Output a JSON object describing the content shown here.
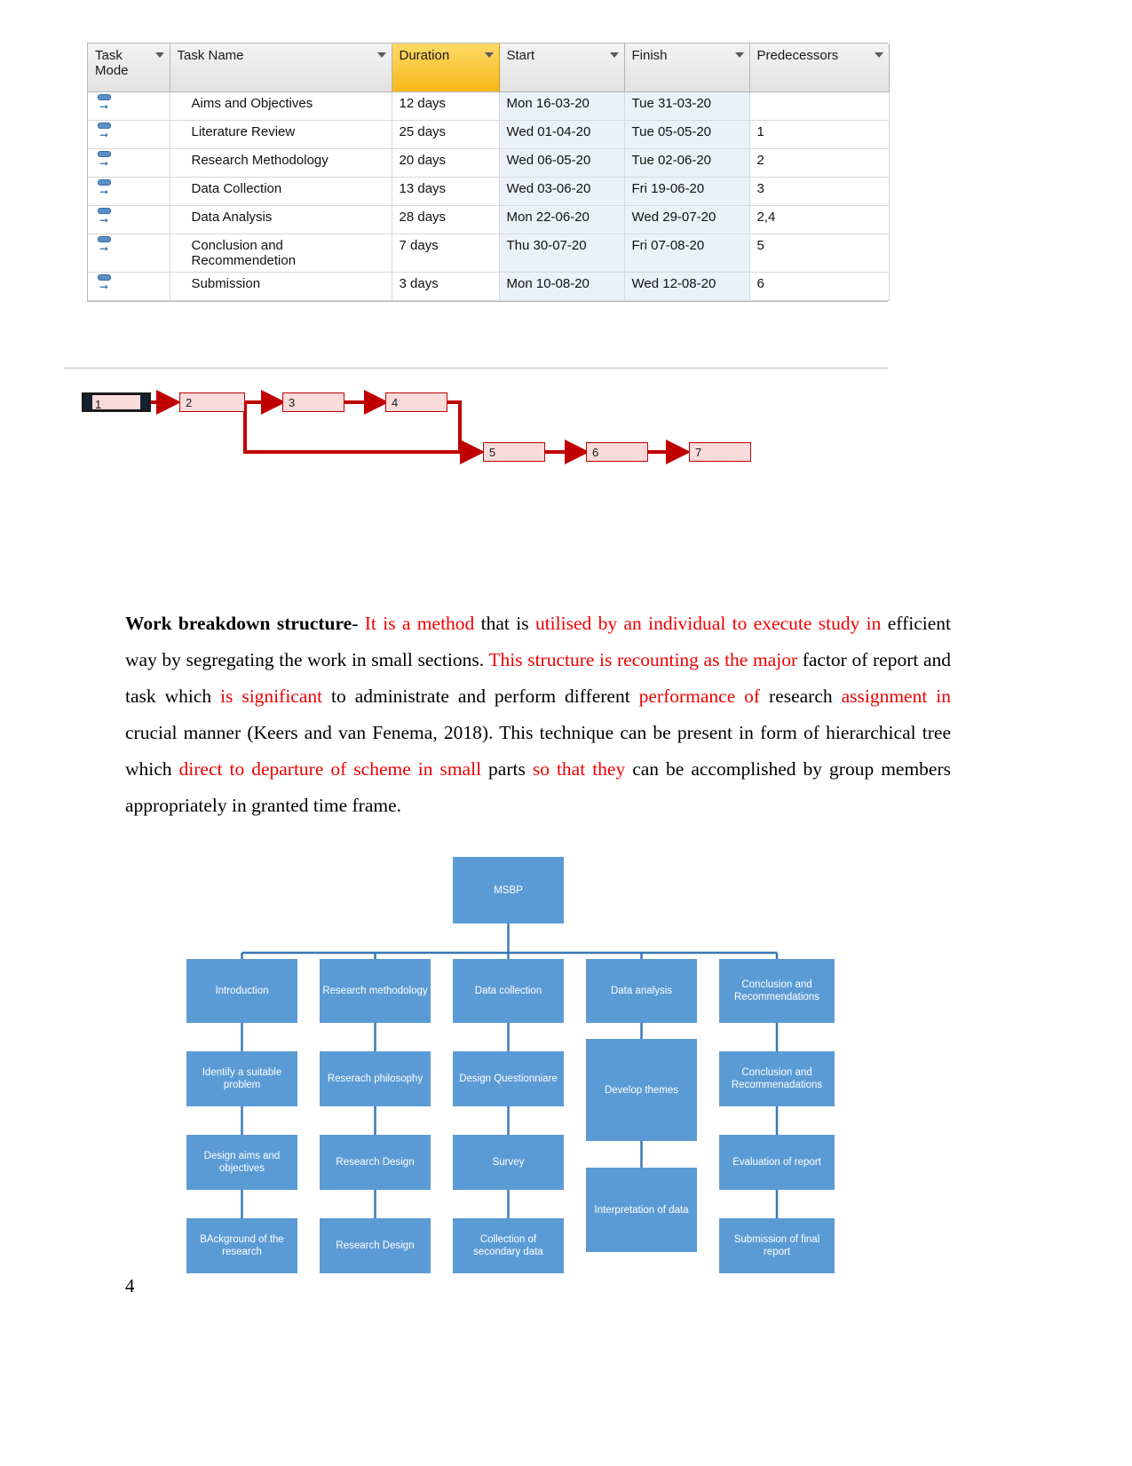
{
  "gantt": {
    "columns": [
      {
        "label": "Task Mode",
        "highlighted": false,
        "has_filter": true
      },
      {
        "label": "Task Name",
        "highlighted": false,
        "has_filter": true
      },
      {
        "label": "Duration",
        "highlighted": true,
        "has_filter": true
      },
      {
        "label": "Start",
        "highlighted": false,
        "has_filter": true
      },
      {
        "label": "Finish",
        "highlighted": false,
        "has_filter": true
      },
      {
        "label": "Predecessors",
        "highlighted": false,
        "has_filter": true
      }
    ],
    "rows": [
      {
        "mode": "auto-schedule-icon",
        "name": "Aims and Objectives",
        "duration": "12 days",
        "start": "Mon 16-03-20",
        "finish": "Tue 31-03-20",
        "predecessors": ""
      },
      {
        "mode": "auto-schedule-icon",
        "name": "Literature Review",
        "duration": "25 days",
        "start": "Wed 01-04-20",
        "finish": "Tue 05-05-20",
        "predecessors": "1"
      },
      {
        "mode": "auto-schedule-icon",
        "name": "Research Methodology",
        "duration": "20 days",
        "start": "Wed 06-05-20",
        "finish": "Tue 02-06-20",
        "predecessors": "2"
      },
      {
        "mode": "auto-schedule-icon",
        "name": "Data Collection",
        "duration": "13 days",
        "start": "Wed 03-06-20",
        "finish": "Fri 19-06-20",
        "predecessors": "3"
      },
      {
        "mode": "auto-schedule-icon",
        "name": "Data Analysis",
        "duration": "28 days",
        "start": "Mon 22-06-20",
        "finish": "Wed 29-07-20",
        "predecessors": "2,4"
      },
      {
        "mode": "auto-schedule-icon",
        "name": "Conclusion and Recommendetion",
        "duration": "7 days",
        "start": "Thu 30-07-20",
        "finish": "Fri 07-08-20",
        "predecessors": "5"
      },
      {
        "mode": "auto-schedule-icon",
        "name": "Submission",
        "duration": "3 days",
        "start": "Mon 10-08-20",
        "finish": "Wed 12-08-20",
        "predecessors": "6"
      }
    ]
  },
  "network_diagram": {
    "node_color": "#fadbdb",
    "line_color": "#c00000",
    "nodes": [
      {
        "id": "1",
        "label": "1",
        "is_start": true
      },
      {
        "id": "2",
        "label": "2",
        "is_start": false
      },
      {
        "id": "3",
        "label": "3",
        "is_start": false
      },
      {
        "id": "4",
        "label": "4",
        "is_start": false
      },
      {
        "id": "5",
        "label": "5",
        "is_start": false
      },
      {
        "id": "6",
        "label": "6",
        "is_start": false
      },
      {
        "id": "7",
        "label": "7",
        "is_start": false
      }
    ],
    "links": [
      {
        "from": "1",
        "to": "2"
      },
      {
        "from": "2",
        "to": "3"
      },
      {
        "from": "3",
        "to": "4"
      },
      {
        "from": "4",
        "to": "5"
      },
      {
        "from": "2",
        "to": "5"
      },
      {
        "from": "5",
        "to": "6"
      },
      {
        "from": "6",
        "to": "7"
      }
    ]
  },
  "paragraph": {
    "segments": [
      {
        "text": "Work breakdown structure",
        "style": "bold"
      },
      {
        "text": "- ",
        "style": "plain"
      },
      {
        "text": "It is a method ",
        "style": "red"
      },
      {
        "text": "that is ",
        "style": "plain"
      },
      {
        "text": "utilised by an individual to execute study in ",
        "style": "red"
      },
      {
        "text": "efficient way by segregating the work in small sections. ",
        "style": "plain"
      },
      {
        "text": "This structure is recounting as the major ",
        "style": "red"
      },
      {
        "text": "factor of report and task which ",
        "style": "plain"
      },
      {
        "text": "is significant ",
        "style": "red"
      },
      {
        "text": "to administrate and perform different ",
        "style": "plain"
      },
      {
        "text": "performance of ",
        "style": "red"
      },
      {
        "text": "research ",
        "style": "plain"
      },
      {
        "text": "assignment in ",
        "style": "red"
      },
      {
        "text": "crucial manner (Keers and van Fenema,  2018). This technique can be present in form of hierarchical tree which ",
        "style": "plain"
      },
      {
        "text": "direct to departure of scheme in small ",
        "style": "red"
      },
      {
        "text": "parts ",
        "style": "plain"
      },
      {
        "text": "so that they ",
        "style": "red"
      },
      {
        "text": "can be accomplished by group members appropriately in granted time frame.",
        "style": "plain"
      }
    ]
  },
  "wbs_chart": {
    "box_color": "#5b9bd5",
    "connector_color": "#3a78b5",
    "root": {
      "label": "MSBP"
    },
    "branches": [
      {
        "header": "Introduction",
        "items": [
          "Identify a suitable problem",
          "Design aims and objectives",
          "BAckground of the research"
        ]
      },
      {
        "header": "Research methodology",
        "items": [
          "Reserach philosophy",
          "Research Design",
          "Research Design"
        ]
      },
      {
        "header": "Data collection",
        "items": [
          "Design Questionniare",
          "Survey",
          "Collection of secondary data"
        ]
      },
      {
        "header": "Data analysis",
        "items": [
          "Develop themes",
          "Interpretation of data"
        ]
      },
      {
        "header": "Conclusion and Recommendations",
        "items": [
          "Conclusion and Recommenadations",
          "Evaluation of report",
          "Submission of final report"
        ]
      }
    ]
  },
  "page": {
    "number": "4"
  }
}
